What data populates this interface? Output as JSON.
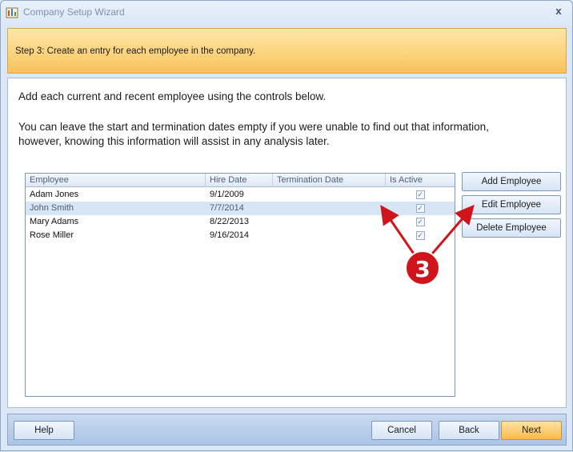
{
  "window": {
    "title": "Company Setup Wizard",
    "close_glyph": "x"
  },
  "step": {
    "text": "Step 3: Create an entry for each employee in the company."
  },
  "instructions": {
    "line1": "Add each current and recent employee using the controls below.",
    "line2": "You can leave the start and termination dates empty if you were unable to find out that information, however, knowing this information will assist in any analysis later."
  },
  "grid": {
    "columns": [
      "Employee",
      "Hire Date",
      "Termination Date",
      "Is Active"
    ],
    "rows": [
      {
        "employee": "Adam Jones",
        "hire_date": "9/1/2009",
        "termination_date": "",
        "is_active": true,
        "selected": false
      },
      {
        "employee": "John Smith",
        "hire_date": "7/7/2014",
        "termination_date": "",
        "is_active": true,
        "selected": true
      },
      {
        "employee": "Mary Adams",
        "hire_date": "8/22/2013",
        "termination_date": "",
        "is_active": true,
        "selected": false
      },
      {
        "employee": "Rose Miller",
        "hire_date": "9/16/2014",
        "termination_date": "",
        "is_active": true,
        "selected": false
      }
    ]
  },
  "side_buttons": {
    "add": "Add Employee",
    "edit": "Edit Employee",
    "delete": "Delete Employee"
  },
  "footer": {
    "help": "Help",
    "cancel": "Cancel",
    "back": "Back",
    "next": "Next"
  },
  "annotation": {
    "badge_number": "3",
    "color": "#d0141b"
  },
  "icons": {
    "app": "wizard-app-icon",
    "close": "close-icon",
    "checkbox": "checkbox-checked-icon"
  }
}
